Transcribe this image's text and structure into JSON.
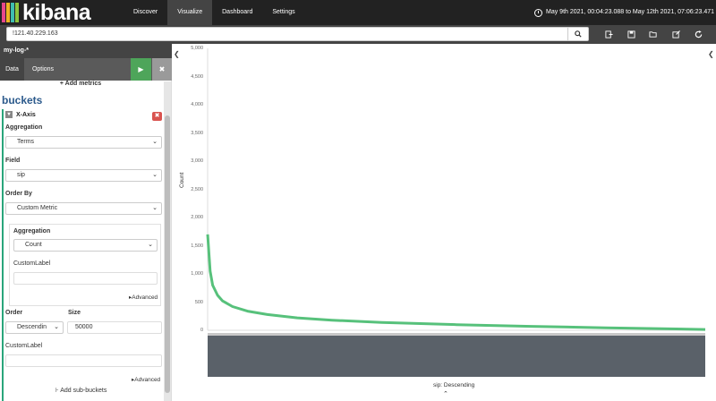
{
  "nav": {
    "logo_text": "kibana",
    "logo_colors": [
      "#e8478b",
      "#f0b323",
      "#3ebeb0",
      "#8cc63f"
    ],
    "items": [
      {
        "label": "Discover",
        "active": false
      },
      {
        "label": "Visualize",
        "active": true
      },
      {
        "label": "Dashboard",
        "active": false
      },
      {
        "label": "Settings",
        "active": false
      }
    ],
    "time_range": "May 9th 2021, 00:04:23.088 to May 12th 2021, 07:06:23.471"
  },
  "query": {
    "value": "!121.40.229.163",
    "search_icon": "search-icon",
    "toolbar_icons": [
      "new-icon",
      "save-icon",
      "open-icon",
      "share-icon",
      "refresh-icon"
    ]
  },
  "sidebar": {
    "index_pattern": "my-log-*",
    "tabs": [
      {
        "label": "Data",
        "active": true
      },
      {
        "label": "Options",
        "active": false
      }
    ],
    "run_icon": "play-icon",
    "discard_icon": "close-icon",
    "add_metrics": "Add metrics",
    "buckets_title": "buckets",
    "xaxis": {
      "title": "X-Axis",
      "aggregation_label": "Aggregation",
      "aggregation_value": "Terms",
      "field_label": "Field",
      "field_value": "sip",
      "order_by_label": "Order By",
      "order_by_value": "Custom Metric",
      "metric": {
        "aggregation_label": "Aggregation",
        "aggregation_value": "Count",
        "custom_label_label": "CustomLabel",
        "custom_label_value": "",
        "advanced": "Advanced"
      },
      "order_label": "Order",
      "order_value": "Descendin",
      "size_label": "Size",
      "size_value": "50000",
      "custom_label_label": "CustomLabel",
      "custom_label_value": "",
      "advanced": "Advanced"
    },
    "add_sub_buckets": "Add sub-buckets"
  },
  "chart_data": {
    "type": "line",
    "ylabel": "Count",
    "xlabel": "sip: Descending",
    "ylim": [
      0,
      5000
    ],
    "y_ticks": [
      "5,000",
      "4,500",
      "4,000",
      "3,500",
      "3,000",
      "2,500",
      "2,000",
      "1,500",
      "1,000",
      "500",
      "0"
    ],
    "line_color": "#57c17b",
    "series": [
      {
        "x_fraction": [
          0.0,
          0.005,
          0.01,
          0.02,
          0.03,
          0.05,
          0.08,
          0.12,
          0.18,
          0.25,
          0.35,
          0.5,
          0.65,
          0.8,
          0.9,
          1.0
        ],
        "values": [
          1700,
          1050,
          800,
          620,
          520,
          420,
          340,
          280,
          220,
          180,
          140,
          100,
          70,
          45,
          30,
          15
        ]
      }
    ]
  }
}
